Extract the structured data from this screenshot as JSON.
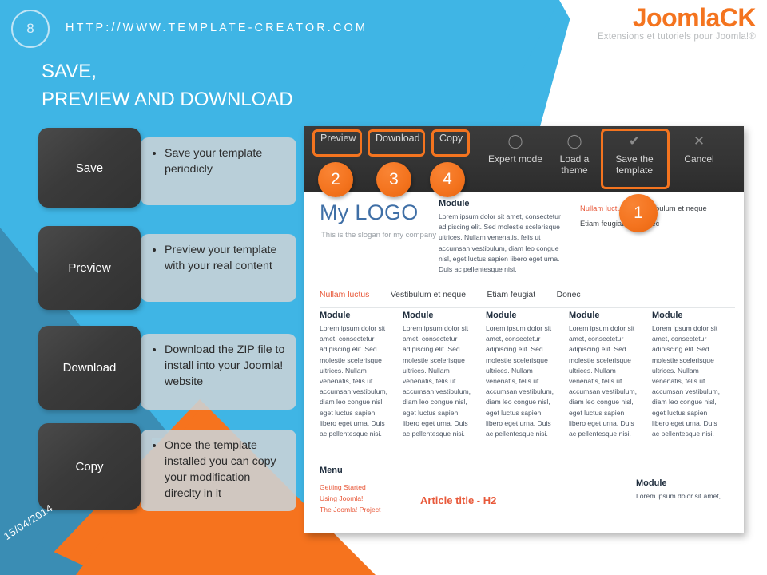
{
  "header": {
    "page_number": "8",
    "site_url": "HTTP://WWW.TEMPLATE-CREATOR.COM",
    "title_line1": "SAVE,",
    "title_line2": "PREVIEW AND DOWNLOAD",
    "logo_text": "JoomlaCK",
    "logo_tagline": "Extensions et tutoriels pour Joomla!®"
  },
  "colors": {
    "light_blue": "#3FB5E5",
    "teal": "#3A8DB4",
    "orange": "#F4741F",
    "dark_box": "#3A3A3A",
    "note_gray": "#CBD3D7"
  },
  "steps": [
    {
      "label": "Save",
      "note": "Save your template periodicly"
    },
    {
      "label": "Preview",
      "note": "Preview your template with your real content"
    },
    {
      "label": "Download",
      "note": "Download the ZIP file to install into your Joomla! website"
    },
    {
      "label": "Copy",
      "note": "Once the template installed you can copy your modification direclty in it"
    }
  ],
  "toolbar": {
    "items": [
      {
        "label": "Preview",
        "icon": "none",
        "type": "text",
        "highlighted": true
      },
      {
        "label": "Download",
        "icon": "none",
        "type": "text",
        "highlighted": true
      },
      {
        "label": "Copy",
        "icon": "none",
        "type": "text",
        "highlighted": true
      },
      {
        "label": "Expert mode",
        "icon": "circle-icon",
        "type": "icon",
        "highlighted": false
      },
      {
        "label": "Load a theme",
        "icon": "circle-icon",
        "type": "icon",
        "highlighted": false
      },
      {
        "label": "Save the template",
        "icon": "check-icon",
        "type": "icon",
        "highlighted": true
      },
      {
        "label": "Cancel",
        "icon": "close-icon",
        "type": "icon",
        "highlighted": false
      }
    ],
    "icon_glyphs": {
      "circle-icon": "◯",
      "check-icon": "✔",
      "close-icon": "✕"
    }
  },
  "badges": [
    {
      "number": "1"
    },
    {
      "number": "2"
    },
    {
      "number": "3"
    },
    {
      "number": "4"
    }
  ],
  "template_preview": {
    "logo": "My LOGO",
    "slogan": "This is the slogan for my company",
    "module_title": "Module",
    "module_body": "Lorem ipsum dolor sit amet, consectetur adipiscing elit. Sed molestie scelerisque ultrices. Nullam venenatis, felis ut accumsan vestibulum, diam leo congue nisl, eget luctus sapien libero eget urna. Duis ac pellentesque nisi.",
    "top_nav": [
      "Nullam luctus",
      "Vestibulum et neque",
      "Etiam feugiat",
      "Donec"
    ],
    "main_nav": [
      "Nullam luctus",
      "Vestibulum et neque",
      "Etiam feugiat",
      "Donec"
    ],
    "columns": [
      {
        "title": "Module"
      },
      {
        "title": "Module"
      },
      {
        "title": "Module"
      },
      {
        "title": "Module"
      },
      {
        "title": "Module"
      }
    ],
    "menu_heading": "Menu",
    "menu_links": [
      "Getting Started",
      "Using Joomla!",
      "The Joomla! Project"
    ],
    "article_title": "Article title - H2",
    "bottom_module_title": "Module",
    "bottom_module_body": "Lorem ipsum dolor sit amet,"
  },
  "footer": {
    "date": "15/04/2014"
  }
}
